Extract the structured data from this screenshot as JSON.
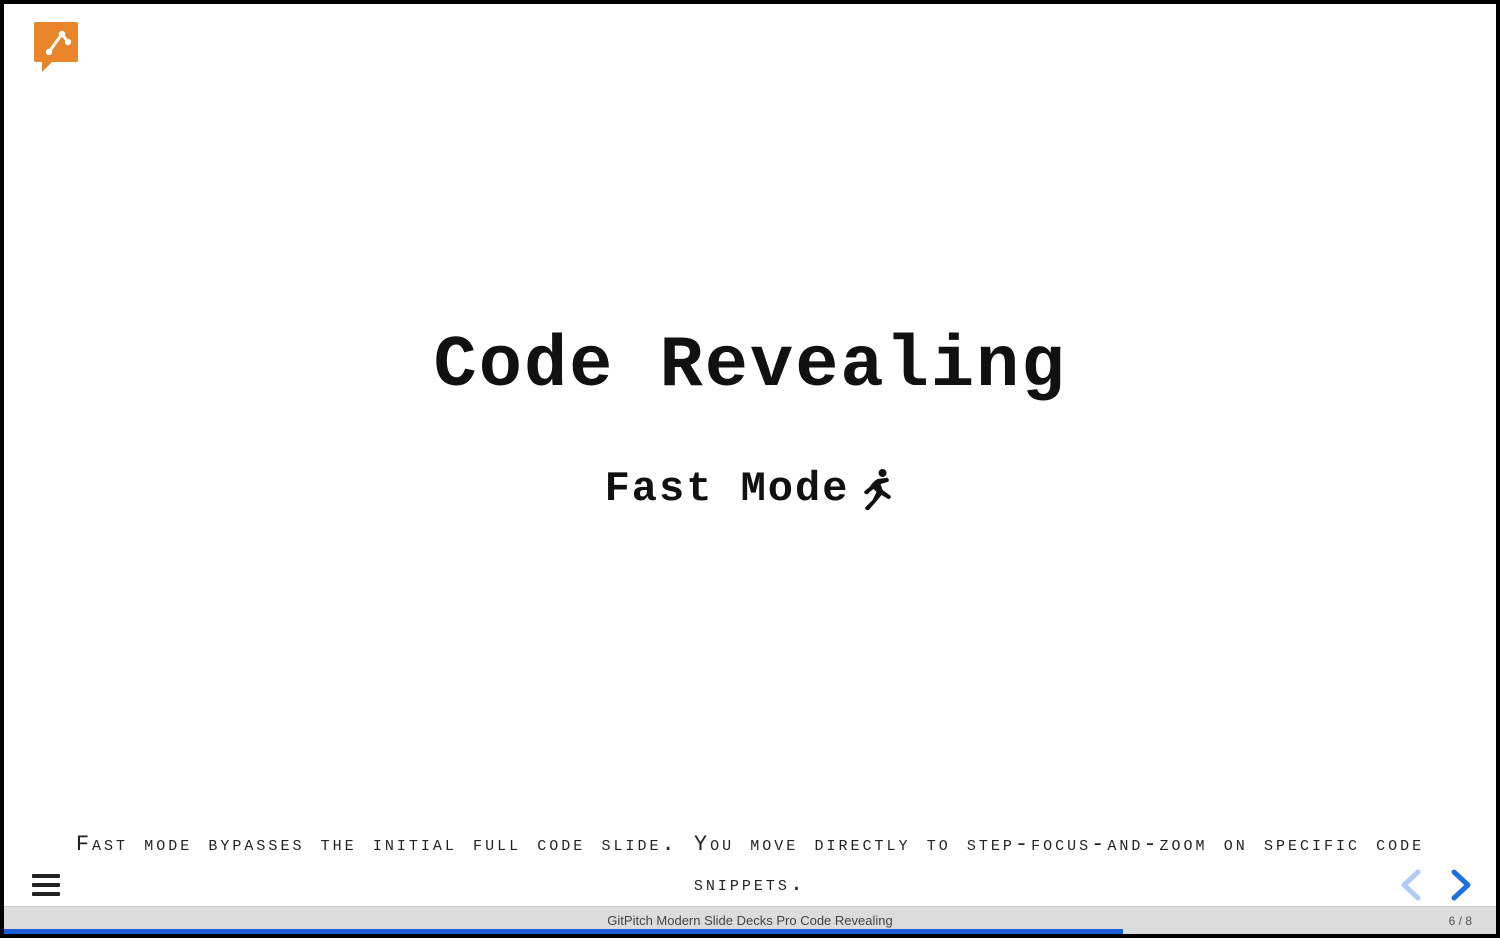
{
  "logo": {
    "name": "gitpitch-logo",
    "color": "#e8852b"
  },
  "slide": {
    "title": "Code Revealing",
    "subtitle": "Fast Mode",
    "subtitle_icon": "running-person-icon",
    "description": "Fast mode bypasses the initial full code slide. You move directly to step-focus-and-zoom on specific code snippets."
  },
  "nav": {
    "prev_enabled": false,
    "next_enabled": true,
    "arrow_color": "#1e6fe0",
    "disabled_color": "#9fbbe8"
  },
  "status": {
    "title": "GitPitch Modern Slide Decks Pro Code Revealing",
    "page_current": 6,
    "page_total": 8,
    "page_label": "6 / 8"
  },
  "progress": {
    "percent": 75
  }
}
